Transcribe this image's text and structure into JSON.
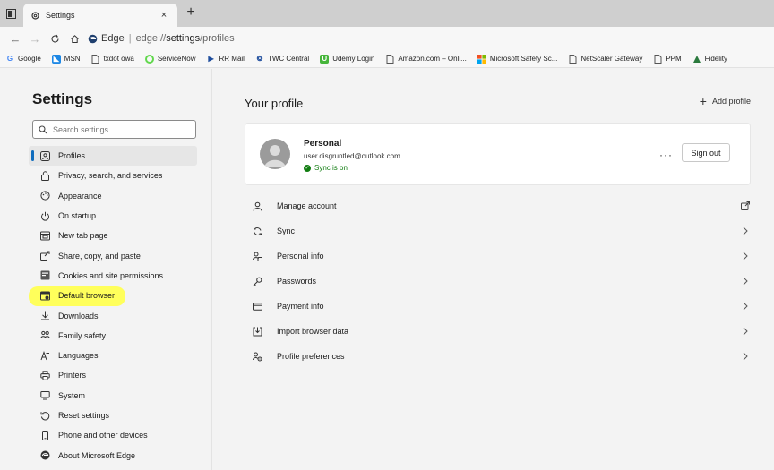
{
  "browser": {
    "tab_title": "Settings",
    "address_brand": "Edge",
    "address_prefix": "edge://",
    "address_bold": "settings",
    "address_suffix": "/profiles"
  },
  "bookmarks": [
    {
      "label": "Google",
      "icon": "google-icon",
      "color": "#4285f4"
    },
    {
      "label": "MSN",
      "icon": "msn-icon",
      "color": "#1e88e5"
    },
    {
      "label": "txdot owa",
      "icon": "page-icon",
      "color": "#555555"
    },
    {
      "label": "ServiceNow",
      "icon": "servicenow-icon",
      "color": "#62d84e"
    },
    {
      "label": "RR Mail",
      "icon": "rrmail-icon",
      "color": "#1f4e9e"
    },
    {
      "label": "TWC Central",
      "icon": "twc-icon",
      "color": "#1f4e9e"
    },
    {
      "label": "Udemy Login",
      "icon": "udemy-icon",
      "color": "#46b53a"
    },
    {
      "label": "Amazon.com – Onli...",
      "icon": "page-icon",
      "color": "#555555"
    },
    {
      "label": "Microsoft Safety Sc...",
      "icon": "microsoft-icon",
      "color": "#f25022"
    },
    {
      "label": "NetScaler Gateway",
      "icon": "page-icon",
      "color": "#555555"
    },
    {
      "label": "PPM",
      "icon": "page-icon",
      "color": "#555555"
    },
    {
      "label": "Fidelity",
      "icon": "fidelity-icon",
      "color": "#2b7a3e"
    }
  ],
  "sidebar": {
    "title": "Settings",
    "search_placeholder": "Search settings",
    "items": [
      {
        "label": "Profiles",
        "icon": "profile-icon"
      },
      {
        "label": "Privacy, search, and services",
        "icon": "lock-icon"
      },
      {
        "label": "Appearance",
        "icon": "appearance-icon"
      },
      {
        "label": "On startup",
        "icon": "power-icon"
      },
      {
        "label": "New tab page",
        "icon": "newtab-icon"
      },
      {
        "label": "Share, copy, and paste",
        "icon": "share-icon"
      },
      {
        "label": "Cookies and site permissions",
        "icon": "cookies-icon"
      },
      {
        "label": "Default browser",
        "icon": "default-browser-icon"
      },
      {
        "label": "Downloads",
        "icon": "download-icon"
      },
      {
        "label": "Family safety",
        "icon": "family-icon"
      },
      {
        "label": "Languages",
        "icon": "languages-icon"
      },
      {
        "label": "Printers",
        "icon": "printer-icon"
      },
      {
        "label": "System",
        "icon": "system-icon"
      },
      {
        "label": "Reset settings",
        "icon": "reset-icon"
      },
      {
        "label": "Phone and other devices",
        "icon": "phone-icon"
      },
      {
        "label": "About Microsoft Edge",
        "icon": "edge-icon"
      }
    ],
    "active_index": 0,
    "highlight_index": 7,
    "highlight_color": "#ffff52"
  },
  "main": {
    "title": "Your profile",
    "add_profile": "Add profile",
    "profile": {
      "name": "Personal",
      "email": "user.disgruntled@outlook.com",
      "sync": "Sync is on",
      "more": "···",
      "sign_out": "Sign out"
    },
    "items": [
      {
        "label": "Manage account",
        "icon": "person-icon",
        "trail": "external-link-icon"
      },
      {
        "label": "Sync",
        "icon": "sync-icon",
        "trail": "chevron-right-icon"
      },
      {
        "label": "Personal info",
        "icon": "personal-info-icon",
        "trail": "chevron-right-icon"
      },
      {
        "label": "Passwords",
        "icon": "key-icon",
        "trail": "chevron-right-icon"
      },
      {
        "label": "Payment info",
        "icon": "card-icon",
        "trail": "chevron-right-icon"
      },
      {
        "label": "Import browser data",
        "icon": "import-icon",
        "trail": "chevron-right-icon"
      },
      {
        "label": "Profile preferences",
        "icon": "profile-prefs-icon",
        "trail": "chevron-right-icon"
      }
    ]
  },
  "colors": {
    "accent": "#0f6cbd",
    "sync_green": "#107c10",
    "highlight": "#ffff52"
  }
}
